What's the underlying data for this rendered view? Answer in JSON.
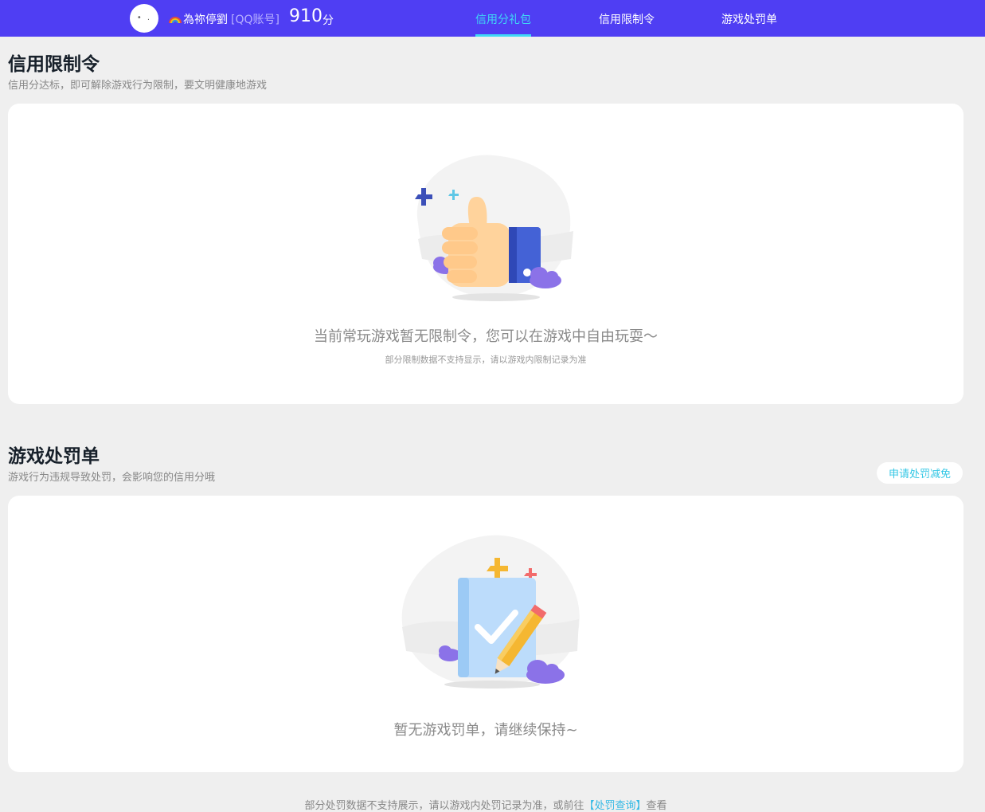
{
  "header": {
    "nickname": "為祢停劉",
    "account_tag": "[QQ账号]",
    "score": "910",
    "score_unit": "分",
    "tabs": [
      {
        "label": "信用分礼包",
        "active": true
      },
      {
        "label": "信用限制令",
        "active": false
      },
      {
        "label": "游戏处罚单",
        "active": false
      }
    ],
    "accent_color": "#4f3ef3",
    "active_tab_color": "#3fd8f5"
  },
  "restriction": {
    "title": "信用限制令",
    "subtitle": "信用分达标，即可解除游戏行为限制，要文明健康地游戏",
    "empty_text": "当前常玩游戏暂无限制令，您可以在游戏中自由玩耍～",
    "empty_note": "部分限制数据不支持显示，请以游戏内限制记录为准",
    "illustration_icon": "thumbs-up-icon"
  },
  "penalty": {
    "title": "游戏处罚单",
    "subtitle": "游戏行为违规导致处罚，会影响您的信用分哦",
    "apply_button": "申请处罚减免",
    "empty_text": "暂无游戏罚单，请继续保持~",
    "illustration_icon": "checklist-pencil-icon"
  },
  "footer": {
    "note_prefix": "部分处罚数据不支持展示，请以游戏内处罚记录为准，或前往",
    "link_text": "【处罚查询】",
    "note_suffix": "查看"
  }
}
